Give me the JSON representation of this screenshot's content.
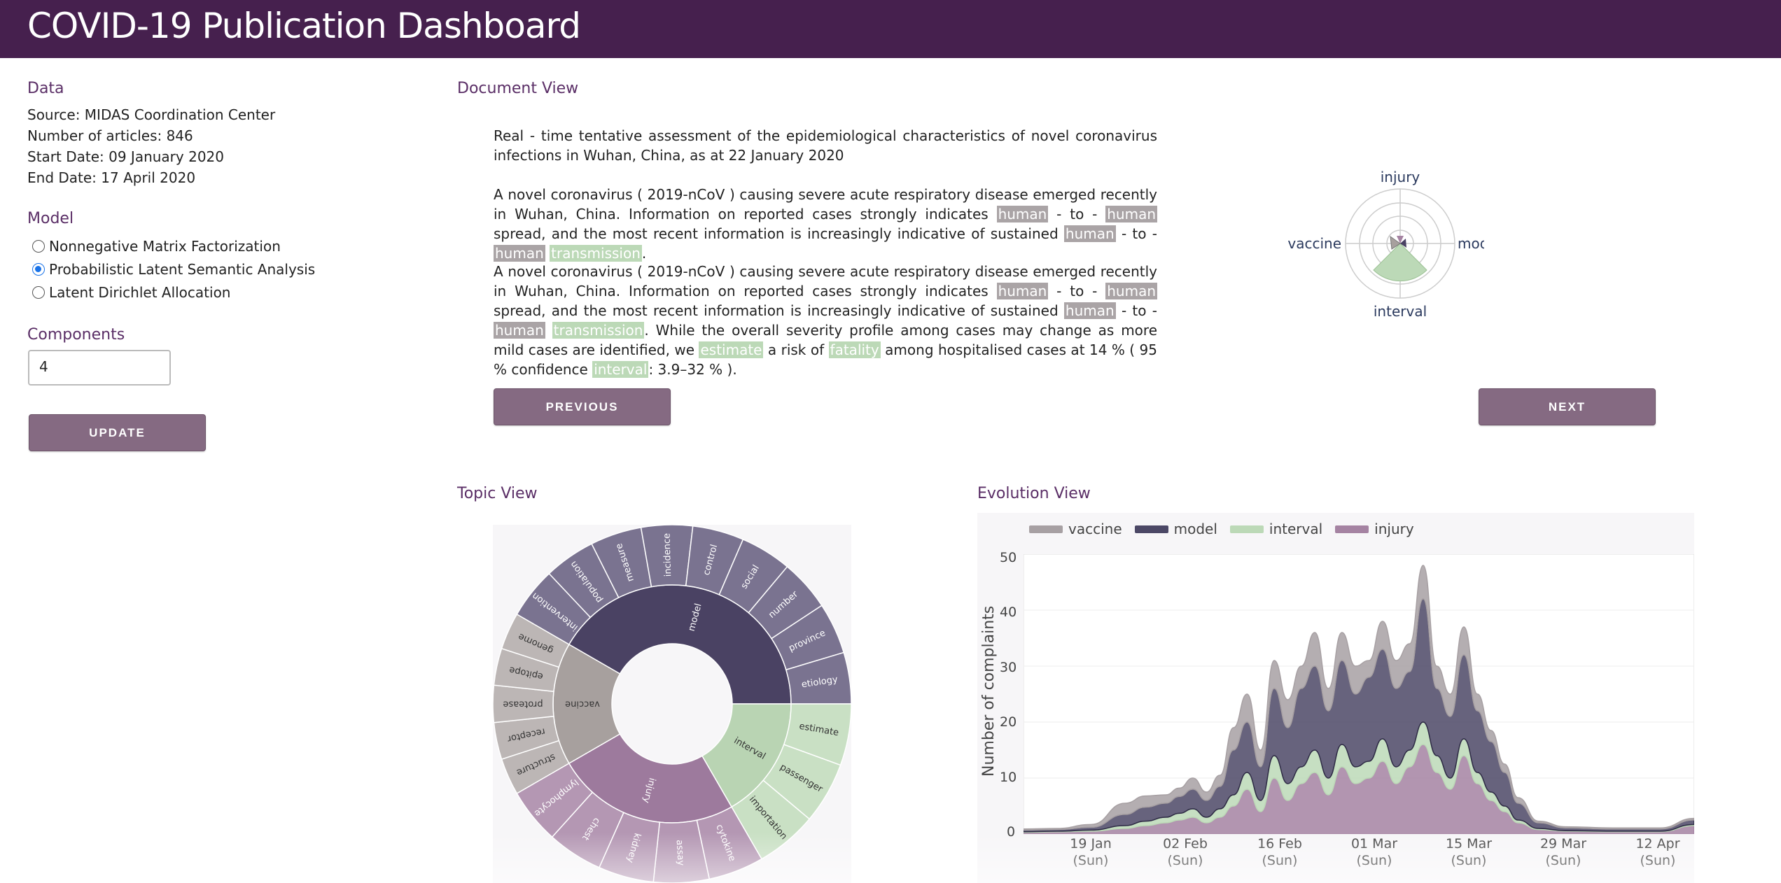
{
  "header": {
    "title": "COVID-19 Publication Dashboard"
  },
  "data_section": {
    "title": "Data",
    "source": "Source: MIDAS Coordination Center",
    "articles": "Number of articles: 846",
    "start": "Start Date: 09 January 2020",
    "end": "End Date: 17 April 2020"
  },
  "model_section": {
    "title": "Model",
    "options": [
      {
        "label": "Nonnegative Matrix Factorization",
        "checked": false
      },
      {
        "label": "Probabilistic Latent Semantic Analysis",
        "checked": true
      },
      {
        "label": "Latent Dirichlet Allocation",
        "checked": false
      }
    ]
  },
  "components": {
    "title": "Components",
    "value": "4"
  },
  "update_label": "UPDATE",
  "document_view": {
    "title": "Document View",
    "title_text": "Real - time tentative assessment of the epidemiological characteristics of novel coronavirus infections in Wuhan, China, as at 22 January 2020",
    "previous_label": "PREVIOUS",
    "next_label": "NEXT"
  },
  "radar": {
    "labels": [
      "injury",
      "model",
      "interval",
      "vaccine"
    ]
  },
  "topic_view": {
    "title": "Topic View",
    "inner": [
      "model",
      "interval",
      "injury",
      "vaccine"
    ],
    "outer": {
      "model": [
        "intervention",
        "population",
        "measure",
        "incidence",
        "control",
        "social",
        "number",
        "province",
        "etiology"
      ],
      "interval": [
        "estimate",
        "passenger",
        "importation"
      ],
      "injury": [
        "cytokine",
        "assay",
        "kidney",
        "chest",
        "lymphocyte"
      ],
      "vaccine": [
        "structure",
        "receptor",
        "protease",
        "epitope",
        "genome"
      ]
    }
  },
  "evolution_view": {
    "title": "Evolution View",
    "ylabel": "Number of complaints",
    "yticks": [
      "0",
      "10",
      "20",
      "30",
      "40",
      "50"
    ],
    "xticks": [
      {
        "date": "19 Jan",
        "day": "(Sun)"
      },
      {
        "date": "02 Feb",
        "day": "(Sun)"
      },
      {
        "date": "16 Feb",
        "day": "(Sun)"
      },
      {
        "date": "01 Mar",
        "day": "(Sun)"
      },
      {
        "date": "15 Mar",
        "day": "(Sun)"
      },
      {
        "date": "29 Mar",
        "day": "(Sun)"
      },
      {
        "date": "12 Apr",
        "day": "(Sun)"
      }
    ],
    "legend": [
      {
        "name": "vaccine",
        "color": "#a7a0a3"
      },
      {
        "name": "model",
        "color": "#4c4866"
      },
      {
        "name": "interval",
        "color": "#bcd9b7"
      },
      {
        "name": "injury",
        "color": "#a583a2"
      }
    ]
  },
  "colors": {
    "header": "#46204e",
    "model": "#4a4263",
    "interval": "#b9d4b3",
    "injury": "#9d7a9d",
    "vaccine": "#a7a09e",
    "button": "#856a82"
  },
  "chart_data": {
    "type": "area",
    "title": "",
    "xlabel": "",
    "ylabel": "Number of complaints",
    "ylim": [
      0,
      50
    ],
    "x": [
      "2020-01-09",
      "2020-01-14",
      "2020-01-19",
      "2020-01-24",
      "2020-01-27",
      "2020-01-30",
      "2020-02-01",
      "2020-02-03",
      "2020-02-05",
      "2020-02-07",
      "2020-02-09",
      "2020-02-11",
      "2020-02-13",
      "2020-02-15",
      "2020-02-17",
      "2020-02-19",
      "2020-02-21",
      "2020-02-23",
      "2020-02-25",
      "2020-02-27",
      "2020-02-29",
      "2020-03-02",
      "2020-03-04",
      "2020-03-06",
      "2020-03-08",
      "2020-03-10",
      "2020-03-12",
      "2020-03-14",
      "2020-03-16",
      "2020-03-18",
      "2020-03-20",
      "2020-03-22",
      "2020-03-25",
      "2020-03-29",
      "2020-04-05",
      "2020-04-12",
      "2020-04-17"
    ],
    "series": [
      {
        "name": "injury",
        "values": [
          0.3,
          0.4,
          0.5,
          1,
          1.5,
          2,
          2.5,
          3,
          2,
          3,
          5,
          8,
          4,
          10,
          6,
          9,
          11,
          7,
          12,
          9,
          10,
          13,
          9,
          12,
          16,
          11,
          8,
          14,
          9,
          6,
          4,
          2,
          0.8,
          0.5,
          0.4,
          0.4,
          1.5
        ]
      },
      {
        "name": "interval",
        "values": [
          0.1,
          0.1,
          0.2,
          0.5,
          0.8,
          1,
          1.2,
          1.5,
          1,
          1.5,
          2,
          3,
          2,
          4,
          3,
          3,
          4,
          3,
          4,
          3,
          3,
          4,
          3,
          3,
          4,
          3,
          2,
          3,
          2,
          1.5,
          1,
          0.5,
          0.2,
          0.1,
          0.1,
          0.1,
          0.2
        ]
      },
      {
        "name": "model",
        "values": [
          0.3,
          0.3,
          0.5,
          2,
          2.5,
          2.5,
          3,
          3.5,
          3,
          4,
          8,
          9,
          6,
          12,
          10,
          14,
          15,
          12,
          15,
          13,
          15,
          16,
          14,
          14,
          22,
          12,
          11,
          15,
          11,
          9,
          6,
          3,
          1,
          0.5,
          0.4,
          0.4,
          0.8
        ]
      },
      {
        "name": "vaccine",
        "values": [
          0.2,
          0.2,
          0.5,
          2,
          2,
          1.5,
          1.5,
          2,
          1.5,
          2,
          4,
          5,
          3,
          5,
          5,
          4,
          6,
          4,
          5,
          5,
          3,
          5,
          5,
          5,
          6,
          4,
          4,
          5,
          3,
          2,
          1.5,
          1,
          0.3,
          0.2,
          0.2,
          0.2,
          0.3
        ]
      }
    ]
  }
}
